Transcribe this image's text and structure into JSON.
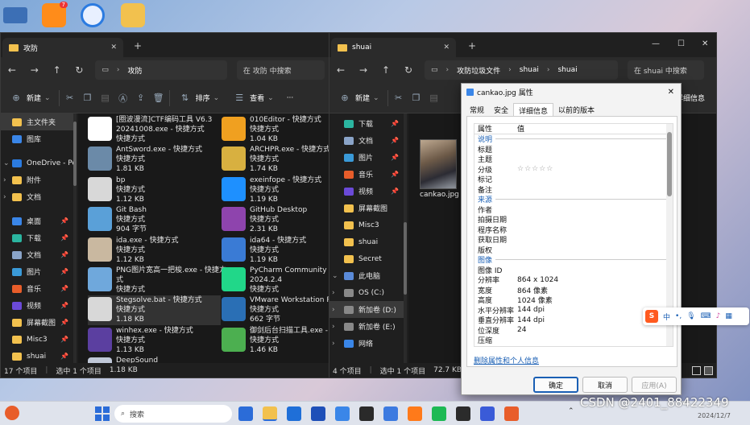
{
  "desktop": {
    "icon_colors": [
      "#3c6fb5",
      "#ff8c1a",
      "#e8f0ff",
      "#f2c14e"
    ],
    "badge": "7"
  },
  "win1": {
    "tab_title": "攻防",
    "path": [
      "攻防"
    ],
    "search_placeholder": "在 攻防 中搜索",
    "toolbar": {
      "new": "新建",
      "sort": "排序",
      "view": "查看",
      "more": "···"
    },
    "sidebar": [
      {
        "label": "主文件夹",
        "type": "home",
        "selected": true
      },
      {
        "label": "图库",
        "type": "gallery"
      },
      {
        "label": "OneDrive - Per",
        "type": "cloud",
        "expand": "⌄"
      },
      {
        "label": "附件",
        "type": "folder",
        "expand": "›"
      },
      {
        "label": "文档",
        "type": "folder",
        "expand": "›"
      },
      {
        "label": "桌面",
        "type": "desktop",
        "pin": "📌"
      },
      {
        "label": "下载",
        "type": "download",
        "pin": "📌"
      },
      {
        "label": "文档",
        "type": "doc",
        "pin": "📌"
      },
      {
        "label": "图片",
        "type": "pic",
        "pin": "📌"
      },
      {
        "label": "音乐",
        "type": "music",
        "pin": "📌"
      },
      {
        "label": "视频",
        "type": "video",
        "pin": "📌"
      },
      {
        "label": "屏幕截图",
        "type": "folder",
        "pin": "📌"
      },
      {
        "label": "Misc3",
        "type": "folder",
        "pin": "📌"
      },
      {
        "label": "shuai",
        "type": "folder",
        "pin": "📌"
      }
    ],
    "files_left": [
      {
        "name": "[圈波漫流]CTF编码工具 V6.3",
        "line2": "20241008.exe - 快捷方式",
        "line3": "快捷方式",
        "line4": "",
        "color": "#ffffff"
      },
      {
        "name": "AntSword.exe - 快捷方式",
        "line2": "快捷方式",
        "line3": "1.81 KB",
        "line4": "",
        "color": "#6b8aa8"
      },
      {
        "name": "bp",
        "line2": "快捷方式",
        "line3": "1.12 KB",
        "line4": "",
        "color": "#d8d8d8"
      },
      {
        "name": "Git Bash",
        "line2": "快捷方式",
        "line3": "904 字节",
        "line4": "",
        "color": "#5aa0d8"
      },
      {
        "name": "ida.exe - 快捷方式",
        "line2": "快捷方式",
        "line3": "1.12 KB",
        "line4": "",
        "color": "#c9b8a0"
      },
      {
        "name": "PNG图片宽高一把梭.exe - 快捷方",
        "line2": "式",
        "line3": "快捷方式",
        "line4": "",
        "color": "#6fa8dc"
      },
      {
        "name": "Stegsolve.bat - 快捷方式",
        "line2": "快捷方式",
        "line3": "1.18 KB",
        "line4": "",
        "color": "#d8d8d8",
        "selected": true
      },
      {
        "name": "winhex.exe - 快捷方式",
        "line2": "快捷方式",
        "line3": "1.13 KB",
        "line4": "",
        "color": "#5b3fa0"
      },
      {
        "name": "DeepSound",
        "line2": "快捷方式",
        "line3": "",
        "line4": "",
        "color": "#c0c8d8"
      }
    ],
    "files_right": [
      {
        "name": "010Editor - 快捷方式",
        "line2": "快捷方式",
        "line3": "1.04 KB",
        "color": "#f0a020"
      },
      {
        "name": "ARCHPR.exe - 快捷方式",
        "line2": "快捷方式",
        "line3": "1.74 KB",
        "color": "#d8b040"
      },
      {
        "name": "exeinfope - 快捷方式",
        "line2": "快捷方式",
        "line3": "1.19 KB",
        "color": "#1e90ff"
      },
      {
        "name": "GitHub Desktop",
        "line2": "快捷方式",
        "line3": "2.31 KB",
        "color": "#8e44ad"
      },
      {
        "name": "ida64 - 快捷方式",
        "line2": "快捷方式",
        "line3": "1.19 KB",
        "color": "#3a7bd5"
      },
      {
        "name": "PyCharm Community Editi",
        "line2": "2024.2.4",
        "line3": "快捷方式",
        "color": "#21d789"
      },
      {
        "name": "VMware Workstation Pro",
        "line2": "快捷方式",
        "line3": "662 字节",
        "color": "#2a6fb5"
      },
      {
        "name": "御剑后台扫描工具.exe - 快捷",
        "line2": "快捷方式",
        "line3": "1.46 KB",
        "color": "#4caf50"
      }
    ],
    "status": {
      "count": "17 个项目",
      "selected": "选中 1 个项目",
      "size": "1.18 KB"
    }
  },
  "win2": {
    "tab_title": "shuai",
    "path": [
      "攻防垃圾文件",
      "shuai",
      "shuai"
    ],
    "search_placeholder": "在 shuai 中搜索",
    "toolbar": {
      "new": "新建"
    },
    "sidebar": [
      {
        "label": "下载",
        "type": "download",
        "pin": "📌"
      },
      {
        "label": "文档",
        "type": "doc",
        "pin": "📌"
      },
      {
        "label": "图片",
        "type": "pic",
        "pin": "📌"
      },
      {
        "label": "音乐",
        "type": "music",
        "pin": "📌"
      },
      {
        "label": "视频",
        "type": "video",
        "pin": "📌"
      },
      {
        "label": "屏幕截图",
        "type": "folder"
      },
      {
        "label": "Misc3",
        "type": "folder"
      },
      {
        "label": "shuai",
        "type": "folder"
      },
      {
        "label": "Secret",
        "type": "folder"
      },
      {
        "label": "此电脑",
        "type": "pc",
        "expand": "⌄"
      },
      {
        "label": "OS (C:)",
        "type": "drive",
        "expand": "›"
      },
      {
        "label": "新加卷 (D:)",
        "type": "drive",
        "expand": "›",
        "selected": true
      },
      {
        "label": "新加卷 (E:)",
        "type": "drive",
        "expand": "›"
      },
      {
        "label": "网络",
        "type": "net",
        "expand": "›"
      }
    ],
    "file": {
      "name": "cankao.jpg"
    },
    "right_header": "详细信息",
    "status": {
      "count": "4 个项目",
      "selected": "选中 1 个项目",
      "size": "72.7 KB"
    }
  },
  "dialog": {
    "title": "cankao.jpg 属性",
    "tabs": [
      "常规",
      "安全",
      "详细信息",
      "以前的版本"
    ],
    "active_tab": 2,
    "header": {
      "k": "属性",
      "v": "值"
    },
    "rows": [
      {
        "group": "说明"
      },
      {
        "k": "标题",
        "v": ""
      },
      {
        "k": "主题",
        "v": ""
      },
      {
        "k": "分级",
        "v": "☆☆☆☆☆"
      },
      {
        "k": "标记",
        "v": ""
      },
      {
        "k": "备注",
        "v": ""
      },
      {
        "group": "来源"
      },
      {
        "k": "作者",
        "v": ""
      },
      {
        "k": "拍摄日期",
        "v": ""
      },
      {
        "k": "程序名称",
        "v": ""
      },
      {
        "k": "获取日期",
        "v": ""
      },
      {
        "k": "版权",
        "v": ""
      },
      {
        "group": "图像"
      },
      {
        "k": "图像 ID",
        "v": ""
      },
      {
        "k": "分辨率",
        "v": "864 x 1024"
      },
      {
        "k": "宽度",
        "v": "864 像素"
      },
      {
        "k": "高度",
        "v": "1024 像素"
      },
      {
        "k": "水平分辨率",
        "v": "144 dpi"
      },
      {
        "k": "垂直分辨率",
        "v": "144 dpi"
      },
      {
        "k": "位深度",
        "v": "24"
      },
      {
        "k": "压缩",
        "v": ""
      }
    ],
    "remove_link": "删除属性和个人信息",
    "buttons": {
      "ok": "确定",
      "cancel": "取消",
      "apply": "应用(A)"
    }
  },
  "ime": {
    "logo": "S",
    "lang": "中"
  },
  "taskbar": {
    "search": "搜索",
    "watermark": "CSDN @2401_88422349",
    "clock": "2024/12/7",
    "icon_colors": [
      "#2b6cd8",
      "#f2c14e",
      "#1f6fd8",
      "#1e4fb8",
      "#3a86e8",
      "#2a2a2a",
      "#3c7ae0",
      "#ff7a1a",
      "#1db954",
      "#2b2b2b",
      "#3a5bd8",
      "#e85d2a"
    ]
  }
}
